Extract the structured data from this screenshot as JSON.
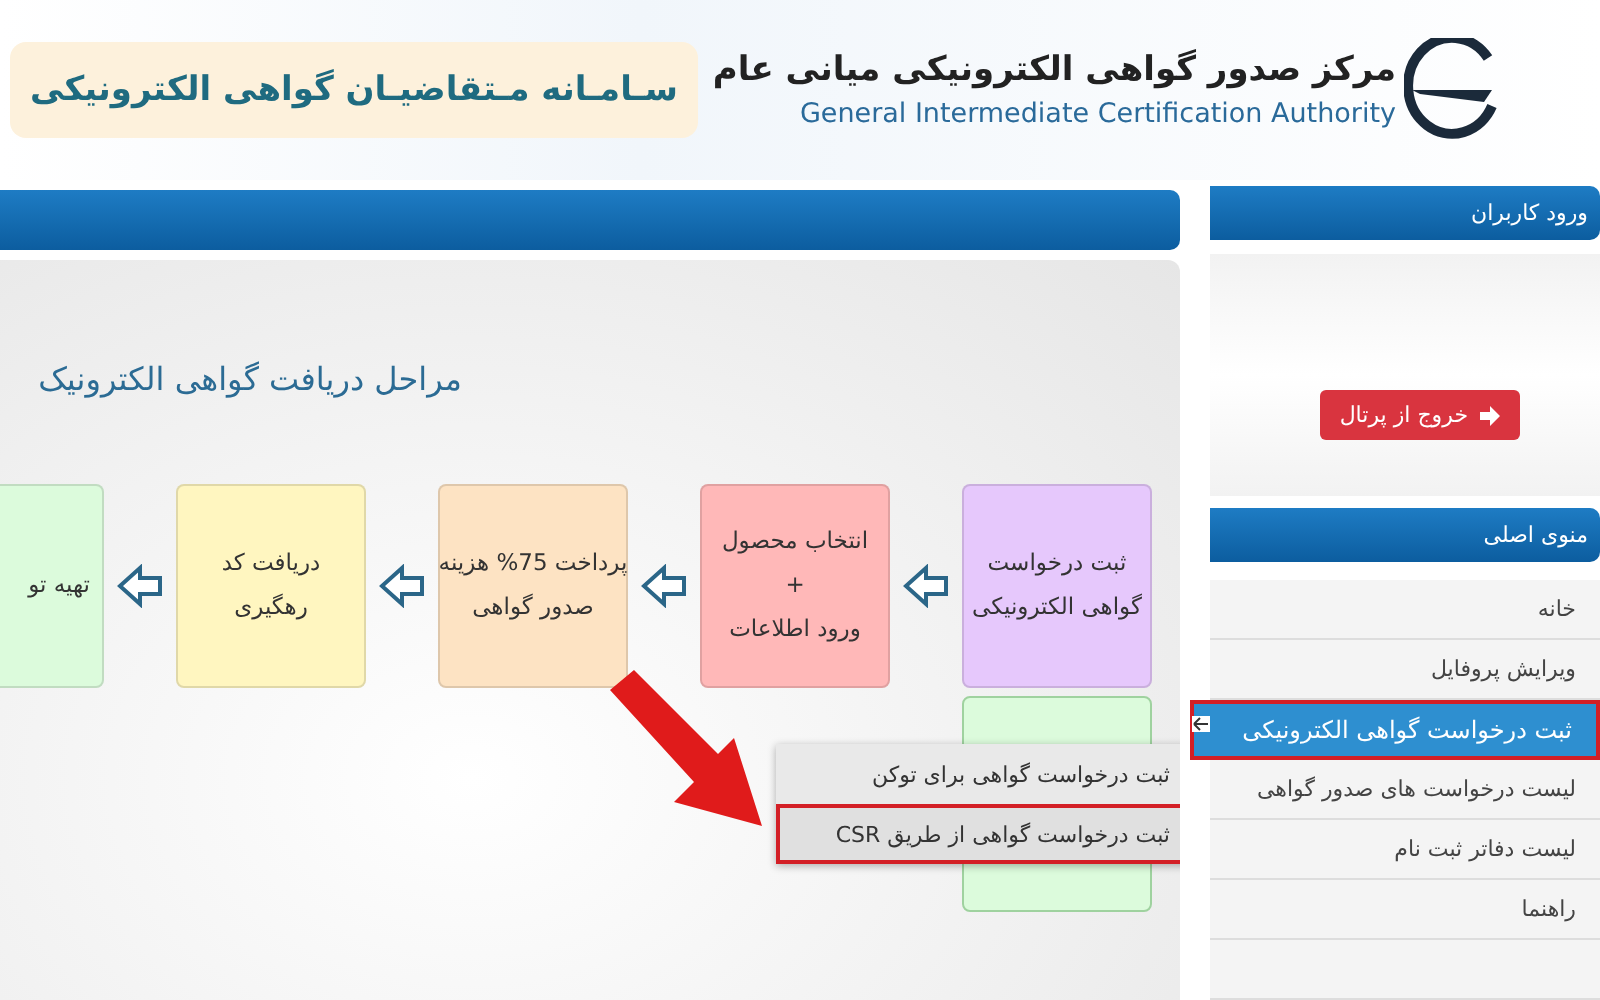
{
  "header": {
    "org_title": "مرکز صدور گواهی الکترونیکی میانی عام",
    "org_subtitle": "General Intermediate Certification Authority",
    "portal_title": "سـامـانه مـتقاضیـان گواهی الکترونیکی"
  },
  "main": {
    "heading": "مراحل دریافت گواهی الکترونیک",
    "steps": [
      {
        "lines": [
          "ثبت درخواست",
          "گواهی الکترونیکی"
        ],
        "color": "#e6c8fc"
      },
      {
        "lines": [
          "انتخاب محصول",
          "+",
          "ورود اطلاعات"
        ],
        "color": "#ffb8b8"
      },
      {
        "lines": [
          "پرداخت 75% هزینه",
          "صدور گواهی"
        ],
        "color": "#fde3c3"
      },
      {
        "lines": [
          "دریافت کد",
          "رهگیری"
        ],
        "color": "#fff6c0"
      },
      {
        "lines": [
          "تهیه تو"
        ],
        "color": "#dcfbdc"
      }
    ],
    "submenu": [
      {
        "label": "ثبت درخواست گواهی برای توکن",
        "selected": false
      },
      {
        "label": "ثبت درخواست گواهی از طریق CSR",
        "selected": true
      }
    ]
  },
  "sidebar": {
    "login_header": "ورود کاربران",
    "logout_button": "خروج از پرتال",
    "menu_header": "منوی اصلی",
    "menu": [
      {
        "label": "خانه",
        "selected": false
      },
      {
        "label": "ویرایش پروفایل",
        "selected": false
      },
      {
        "label": "ثبت درخواست گواهی الکترونیکی",
        "selected": true
      },
      {
        "label": "لیست درخواست های صدور گواهی",
        "selected": false
      },
      {
        "label": "لیست دفاتر ثبت نام",
        "selected": false
      },
      {
        "label": "راهنما",
        "selected": false
      }
    ]
  }
}
